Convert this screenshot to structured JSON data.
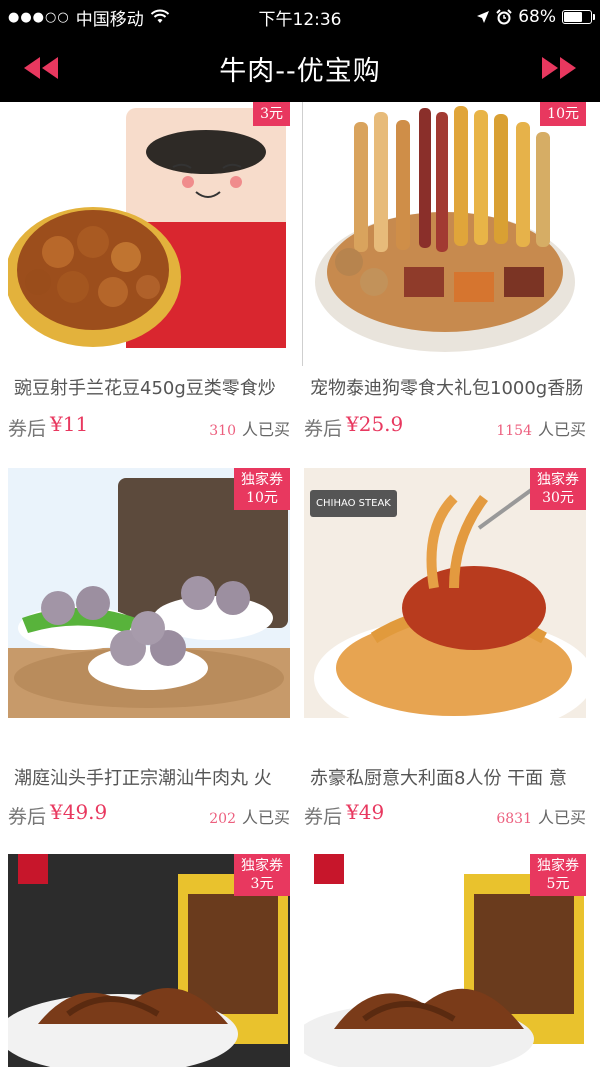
{
  "statusbar": {
    "carrier": "中国移动",
    "time": "下午12:36",
    "battery": "68%",
    "battery_level": 0.68,
    "signal_dots": "●●●○○",
    "icons": [
      "wifi-icon",
      "location-arrow-icon",
      "alarm-icon",
      "battery-icon"
    ]
  },
  "navbar": {
    "title": "牛肉--优宝购",
    "back_icon": "double-left-arrow-icon",
    "forward_icon": "double-right-arrow-icon",
    "accent": "#e8385f"
  },
  "products": [
    {
      "badge_line1": "",
      "badge_line2": "3元",
      "title": "豌豆射手兰花豆450g豆类零食炒",
      "price_label": "券后",
      "price": "¥11",
      "sold_count": "310",
      "sold_text": "人已买",
      "image": "fried-beans-snack"
    },
    {
      "badge_line1": "",
      "badge_line2": "10元",
      "title": "宠物泰迪狗零食大礼包1000g香肠",
      "price_label": "券后",
      "price": "¥25.9",
      "sold_count": "1154",
      "sold_text": "人已买",
      "image": "pet-treats-bowl"
    },
    {
      "badge_line1": "独家券",
      "badge_line2": "10元",
      "title": "潮庭汕头手打正宗潮汕牛肉丸 火",
      "price_label": "券后",
      "price": "¥49.9",
      "sold_count": "202",
      "sold_text": "人已买",
      "image": "beef-balls"
    },
    {
      "badge_line1": "独家券",
      "badge_line2": "30元",
      "title": "赤豪私厨意大利面8人份 干面 意",
      "price_label": "券后",
      "price": "¥49",
      "sold_count": "6831",
      "sold_text": "人已买",
      "image": "spaghetti-bolognese",
      "brand_text": "CHIHAO STEAK"
    },
    {
      "badge_line1": "独家券",
      "badge_line2": "3元",
      "title": "",
      "price_label": "",
      "price": "",
      "sold_count": "",
      "sold_text": "",
      "image": "beef-jerky"
    },
    {
      "badge_line1": "独家券",
      "badge_line2": "5元",
      "title": "",
      "price_label": "",
      "price": "",
      "sold_count": "",
      "sold_text": "",
      "image": "beef-jerky"
    }
  ]
}
